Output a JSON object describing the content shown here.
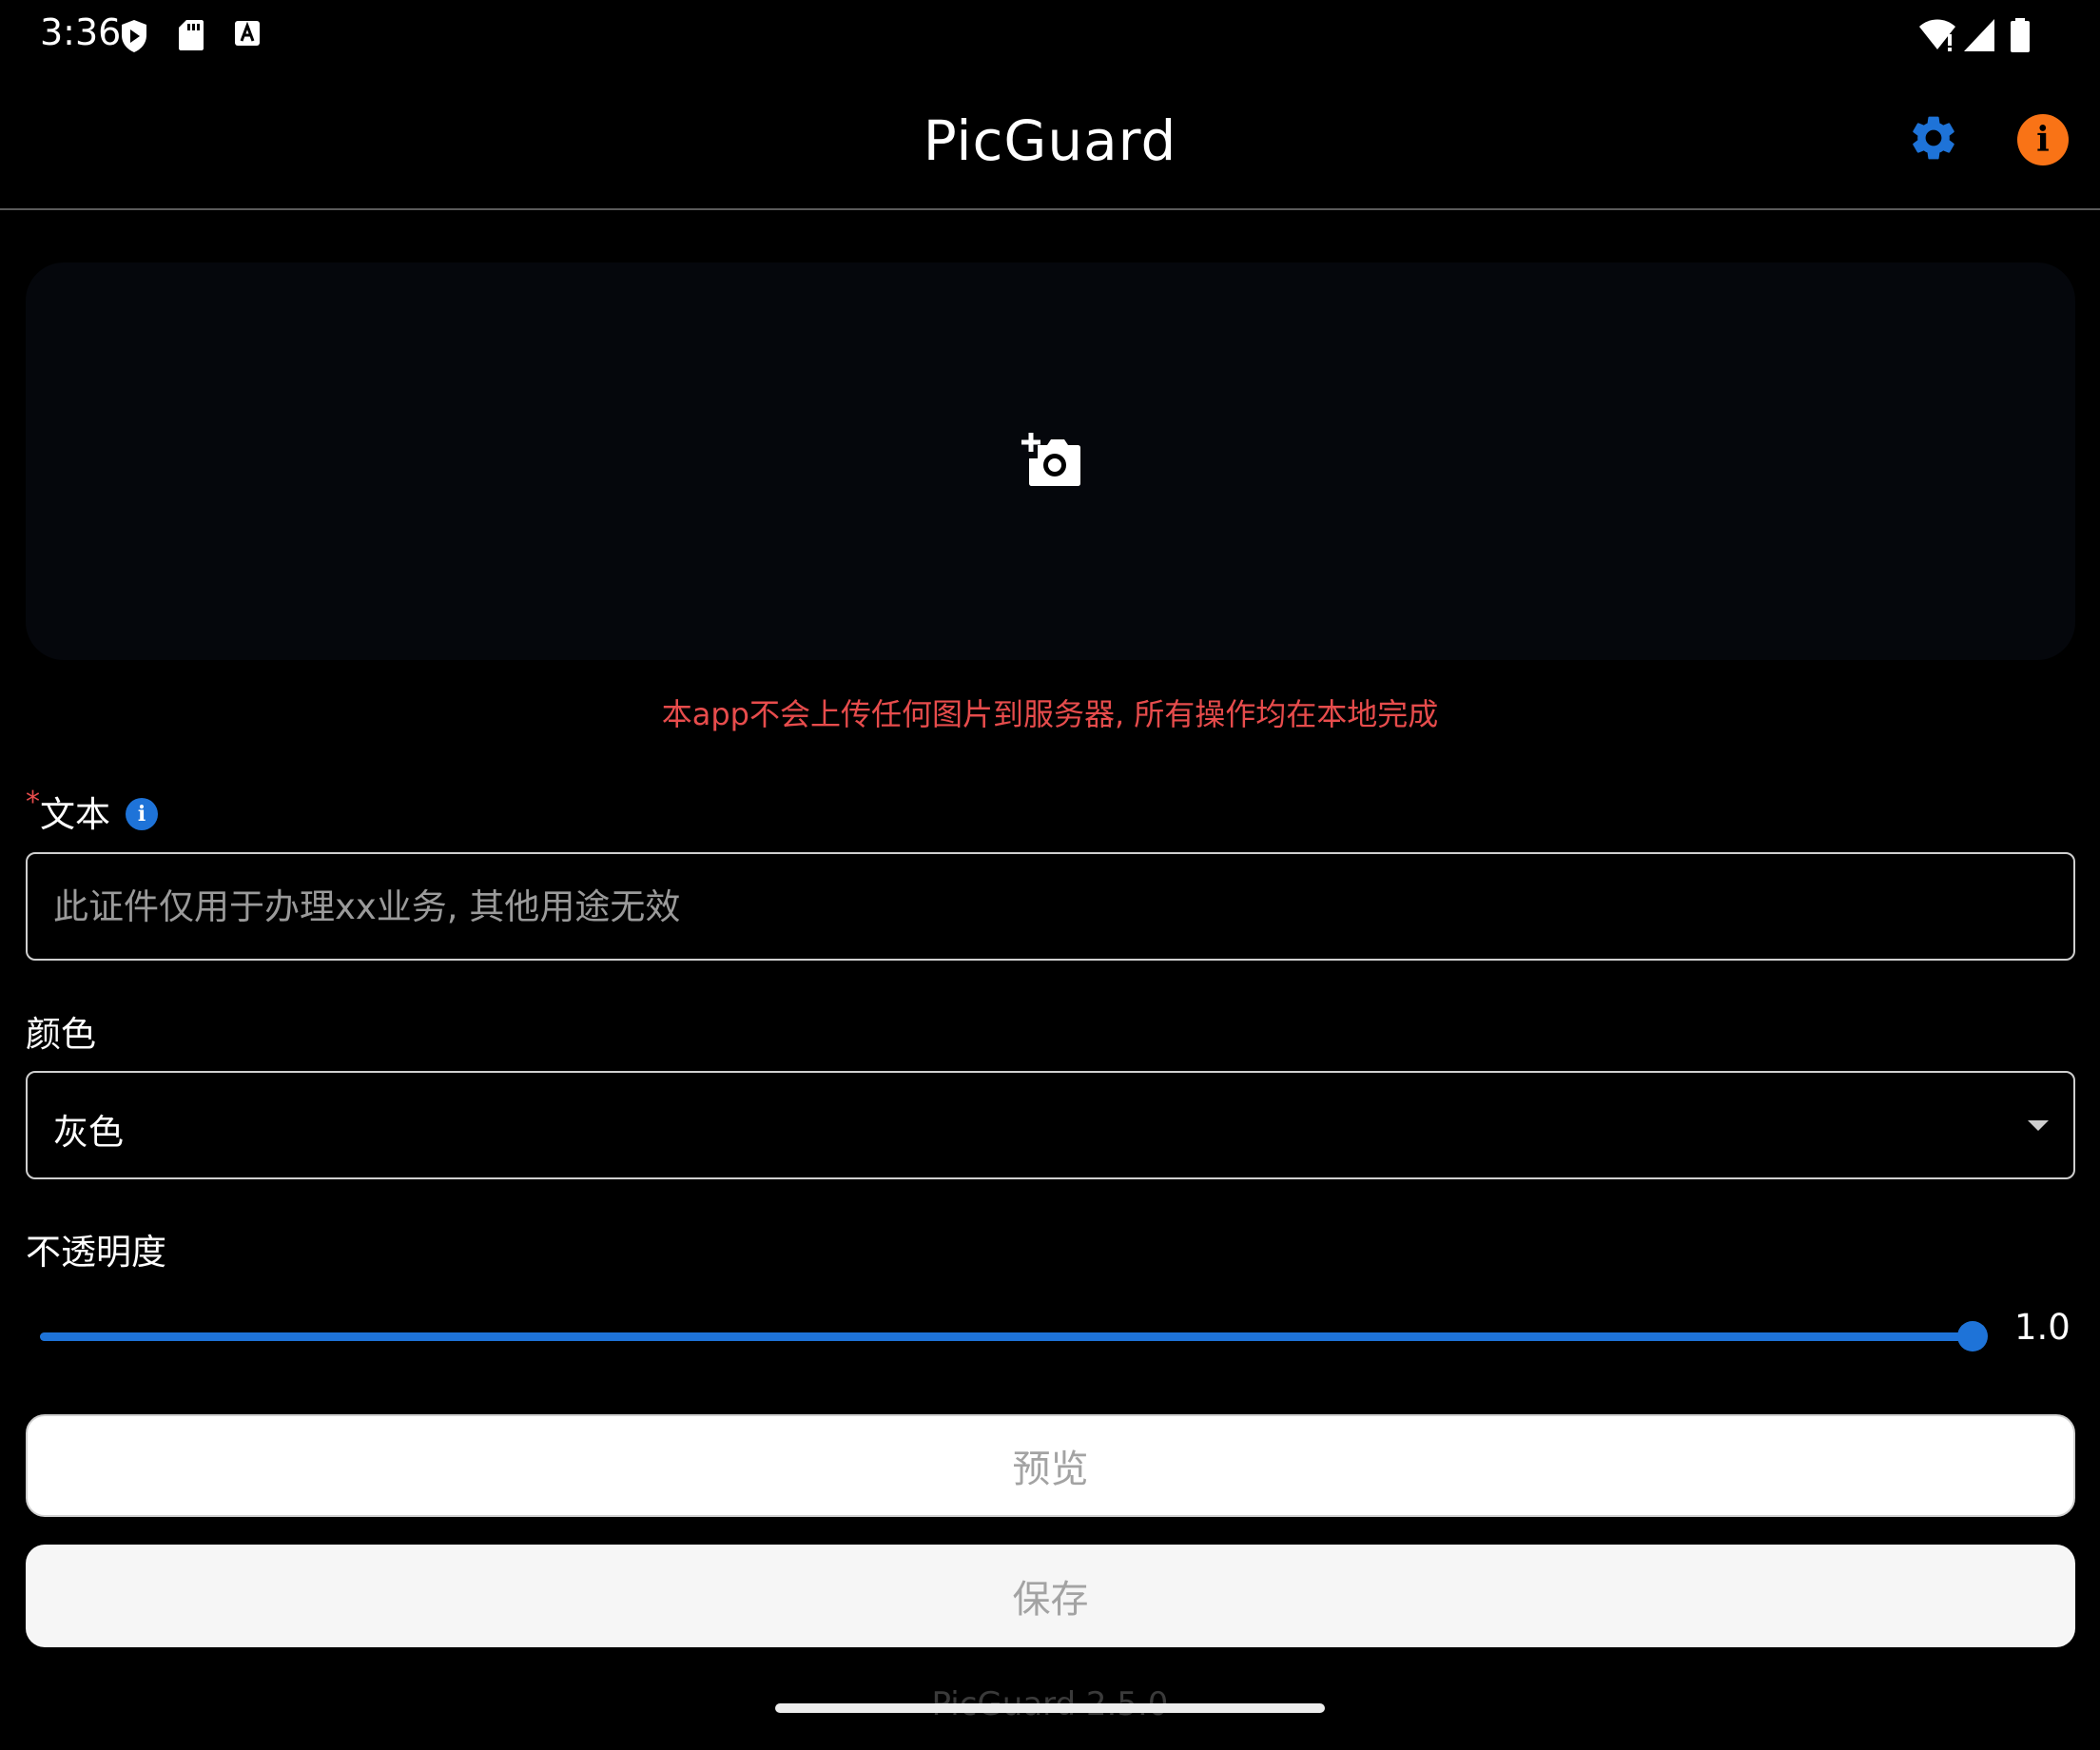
{
  "status_bar": {
    "time": "3:36",
    "left_icons": [
      "shield-play-icon",
      "sd-card-icon",
      "keyboard-a-icon"
    ],
    "right_icons": [
      "wifi-alert-icon",
      "signal-icon",
      "battery-icon"
    ]
  },
  "app_bar": {
    "title": "PicGuard",
    "actions": [
      "gear-icon",
      "info-icon"
    ],
    "colors": {
      "settings": "#1e73d8",
      "info": "#f97316"
    }
  },
  "image_picker": {
    "icon": "add-photo-icon",
    "note": "本app不会上传任何图片到服务器, 所有操作均在本地完成"
  },
  "form": {
    "text": {
      "required_mark": "*",
      "label": "文本",
      "placeholder": "此证件仅用于办理xx业务, 其他用途无效",
      "value": ""
    },
    "color": {
      "label": "颜色",
      "selected": "灰色"
    },
    "opacity": {
      "label": "不透明度",
      "value": 1.0,
      "value_text": "1.0"
    }
  },
  "buttons": {
    "preview": "预览",
    "save": "保存"
  },
  "footer": {
    "version": "PicGuard 2.5.0"
  },
  "colors": {
    "accent": "#1e73d8",
    "warning_text": "#e74c4c",
    "background": "#000000"
  }
}
